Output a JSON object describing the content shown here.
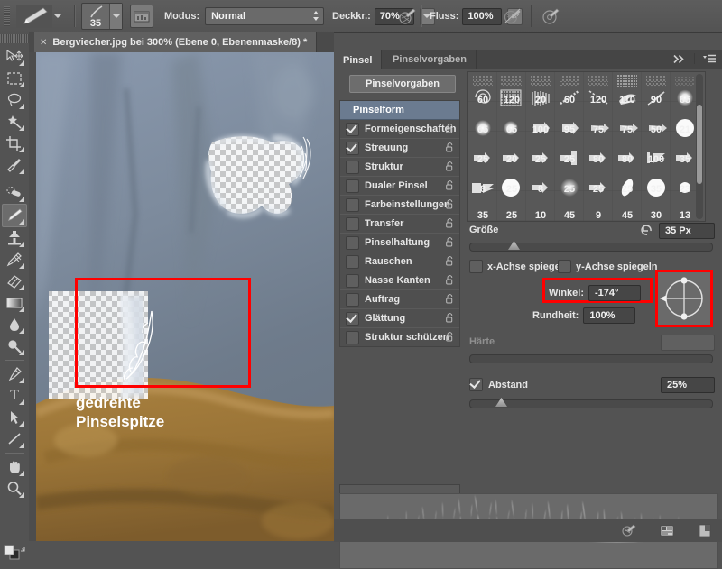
{
  "app": {
    "name": "Adobe Photoshop",
    "accent_annotation_color": "#ff0000",
    "panel_bg": "#535353",
    "selected_row_color": "#6b7b90"
  },
  "options_bar": {
    "tool_preset_icon": "brush-tool-icon",
    "tool_preset_caret": "chevron-down-icon",
    "brush_size_value": "35",
    "brush_picker_caret": "chevron-down-icon",
    "toggle_panel_icon": "brush-panel-toggle-icon",
    "mode_label": "Modus:",
    "mode_value": "Normal",
    "opacity_label": "Deckkr.:",
    "opacity_value": "70%",
    "opacity_pressure_icon": "pressure-opacity-icon",
    "flow_label": "Fluss:",
    "flow_value": "100%",
    "airbrush_icon": "airbrush-icon",
    "pressure_size_icon": "pressure-size-icon"
  },
  "toolbar": {
    "items": [
      {
        "name": "move-tool",
        "icon": "move-icon"
      },
      {
        "name": "marquee-tool",
        "icon": "rectangular-marquee-icon"
      },
      {
        "name": "lasso-tool",
        "icon": "lasso-icon"
      },
      {
        "name": "magic-wand-tool",
        "icon": "magic-wand-icon"
      },
      {
        "name": "crop-tool",
        "icon": "crop-icon"
      },
      {
        "name": "eyedropper-tool",
        "icon": "eyedropper-icon"
      },
      {
        "name": "healing-brush-tool",
        "icon": "healing-brush-icon"
      },
      {
        "name": "brush-tool",
        "icon": "brush-icon",
        "active": true
      },
      {
        "name": "clone-stamp-tool",
        "icon": "clone-stamp-icon"
      },
      {
        "name": "history-brush-tool",
        "icon": "history-brush-icon"
      },
      {
        "name": "eraser-tool",
        "icon": "eraser-icon"
      },
      {
        "name": "gradient-tool",
        "icon": "gradient-icon"
      },
      {
        "name": "blur-tool",
        "icon": "blur-drop-icon"
      },
      {
        "name": "dodge-tool",
        "icon": "dodge-icon"
      },
      {
        "name": "pen-tool",
        "icon": "pen-icon"
      },
      {
        "name": "type-tool",
        "icon": "type-t-icon"
      },
      {
        "name": "path-selection-tool",
        "icon": "path-arrow-icon"
      },
      {
        "name": "line-tool",
        "icon": "line-shape-icon"
      },
      {
        "name": "hand-tool",
        "icon": "hand-icon"
      },
      {
        "name": "zoom-tool",
        "icon": "zoom-magnifier-icon"
      }
    ],
    "foreground_background_icon": "foreground-background-swatch-icon",
    "reset_swatch_icon": "reset-swatch-icon"
  },
  "document": {
    "tab_close_icon": "close-x-icon",
    "tab_title": "Bergviecher.jpg bei 300% (Ebene 0, Ebenenmaske/8) *"
  },
  "canvas_annotation": {
    "label_line1": "gedrehte",
    "label_line2": "Pinselspitze"
  },
  "brush_panel": {
    "tabs": [
      {
        "label": "Pinsel",
        "active": true
      },
      {
        "label": "Pinselvorgaben",
        "active": false
      }
    ],
    "collapse_icon": "double-chevron-right-icon",
    "menu_icon": "panel-menu-icon",
    "presets_button": "Pinselvorgaben",
    "options": [
      {
        "label": "Pinselform",
        "type": "header",
        "checked": false,
        "locked": false
      },
      {
        "label": "Formeigenschaften",
        "type": "item",
        "checked": true
      },
      {
        "label": "Streuung",
        "type": "item",
        "checked": true
      },
      {
        "label": "Struktur",
        "type": "item",
        "checked": false
      },
      {
        "label": "Dualer Pinsel",
        "type": "item",
        "checked": false
      },
      {
        "label": "Farbeinstellungen",
        "type": "item",
        "checked": false
      },
      {
        "label": "Transfer",
        "type": "item",
        "checked": false
      },
      {
        "label": "Pinselhaltung",
        "type": "item",
        "checked": false
      },
      {
        "label": "Rauschen",
        "type": "item",
        "checked": false
      },
      {
        "label": "Nasse Kanten",
        "type": "item",
        "checked": false
      },
      {
        "label": "Auftrag",
        "type": "item",
        "checked": false
      },
      {
        "label": "Glättung",
        "type": "item",
        "checked": true
      },
      {
        "label": "Struktur schützen",
        "type": "item",
        "checked": false
      }
    ],
    "lock_icon": "lock-open-icon",
    "brush_grid": {
      "rows": [
        [
          {
            "size": "60",
            "tip": "scatter-speckle"
          },
          {
            "size": "120",
            "tip": "scatter-speckle"
          },
          {
            "size": "20",
            "tip": "scatter-speckle"
          },
          {
            "size": "60",
            "tip": "scatter-speckle"
          },
          {
            "size": "120",
            "tip": "scatter-speckle"
          },
          {
            "size": "110",
            "tip": "rough-chalk"
          },
          {
            "size": "90",
            "tip": "scatter-speckle"
          },
          {
            "size": "65",
            "tip": "faint-speckle"
          }
        ],
        [
          {
            "size": "65",
            "tip": "spiral"
          },
          {
            "size": "65",
            "tip": "dense-noise"
          },
          {
            "size": "100",
            "tip": "comb-strokes"
          },
          {
            "size": "95",
            "tip": "diagonal-dash"
          },
          {
            "size": "75",
            "tip": "diagonal-dash-thin"
          },
          {
            "size": "75",
            "tip": "feather-swirl"
          },
          {
            "size": "50",
            "tip": "quill"
          },
          {
            "size": "21",
            "tip": "soft-round"
          }
        ],
        [
          {
            "size": "25",
            "tip": "soft-round"
          },
          {
            "size": "20",
            "tip": "soft-round"
          },
          {
            "size": "25",
            "tip": "flat-arrow"
          },
          {
            "size": "25",
            "tip": "flat-arrow"
          },
          {
            "size": "80",
            "tip": "thin-arrow"
          },
          {
            "size": "80",
            "tip": "thin-arrow"
          },
          {
            "size": "100",
            "tip": "thin-arrow"
          },
          {
            "size": "35",
            "tip": "solid-round"
          }
        ],
        [
          {
            "size": "8",
            "tip": "flat-arrow"
          },
          {
            "size": "25",
            "tip": "flat-arrow"
          },
          {
            "size": "8",
            "tip": "flat-arrow"
          },
          {
            "size": "25",
            "tip": "speaker-flat"
          },
          {
            "size": "25",
            "tip": "flat-arrow"
          },
          {
            "size": "25",
            "tip": "flat-arrow"
          },
          {
            "size": "35",
            "tip": "bracket-flag"
          },
          {
            "size": "23",
            "tip": "flat-arrow"
          }
        ],
        [
          {
            "size": "35",
            "tip": "block-flag"
          },
          {
            "size": "25",
            "tip": "solid-round"
          },
          {
            "size": "10",
            "tip": "flat-arrow"
          },
          {
            "size": "45",
            "tip": "soft-round"
          },
          {
            "size": "9",
            "tip": "flat-arrow"
          },
          {
            "size": "45",
            "tip": "ellipse-tilt"
          },
          {
            "size": "30",
            "tip": "solid-round"
          },
          {
            "size": "13",
            "tip": "small-round"
          }
        ]
      ]
    },
    "size": {
      "label": "Größe",
      "reset_icon": "reset-arrow-icon",
      "value": "35 Px",
      "slider_percent": 18
    },
    "flip_x": {
      "label": "x-Achse spiegeln",
      "checked": false
    },
    "flip_y": {
      "label": "y-Achse spiegeln",
      "checked": false
    },
    "angle": {
      "label": "Winkel:",
      "value": "-174°",
      "highlighted": true
    },
    "roundness": {
      "label": "Rundheit:",
      "value": "100%"
    },
    "dial": {
      "name": "angle-dial",
      "highlighted": true
    },
    "hardness": {
      "label": "Härte",
      "value": "",
      "disabled": true,
      "slider_percent": 0
    },
    "spacing": {
      "label": "Abstand",
      "checked": true,
      "value": "25%",
      "slider_percent": 12
    },
    "stroke_preview_name": "brush-stroke-preview"
  },
  "status_bar": {
    "icons": [
      {
        "name": "brush-preview-toggle-icon"
      },
      {
        "name": "new-brush-preset-icon"
      },
      {
        "name": "delete-brush-icon"
      }
    ]
  }
}
